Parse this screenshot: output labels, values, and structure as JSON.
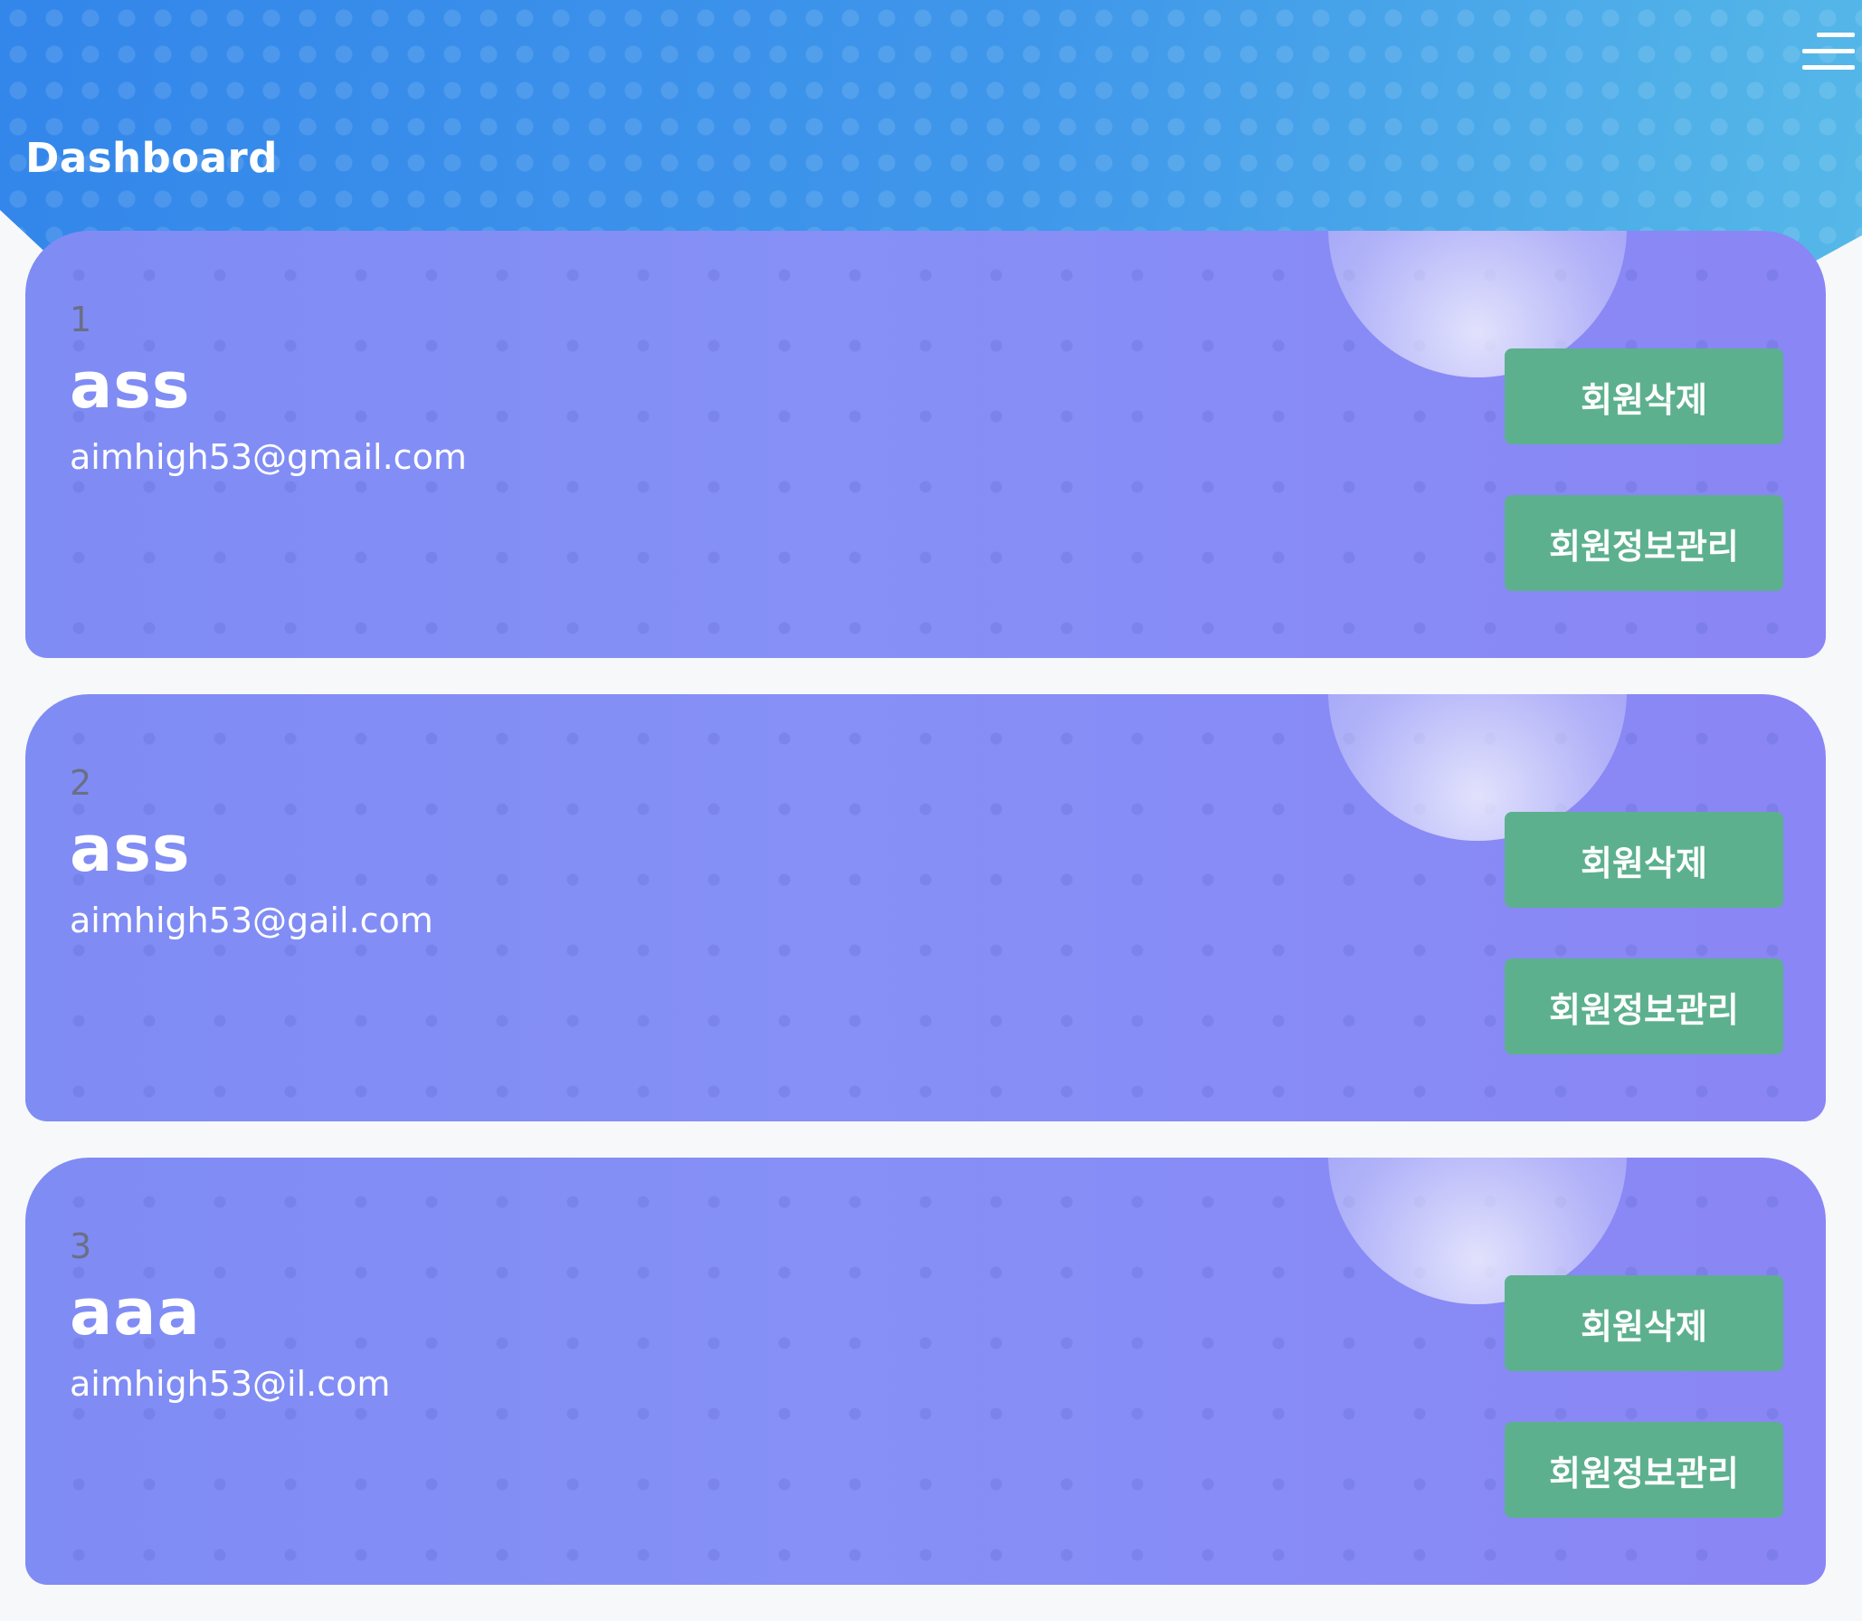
{
  "header": {
    "title": "Dashboard",
    "menu_icon": "hamburger-menu-icon"
  },
  "colors": {
    "header_gradient_start": "#3386ea",
    "header_gradient_end": "#55b8e8",
    "card_background": "#8690f6",
    "button_background": "#5cb08e",
    "page_background": "#f7f8fa"
  },
  "users": [
    {
      "number": "1",
      "name": "ass",
      "email": "aimhigh53@gmail.com",
      "delete_label": "회원삭제",
      "manage_label": "회원정보관리"
    },
    {
      "number": "2",
      "name": "ass",
      "email": "aimhigh53@gail.com",
      "delete_label": "회원삭제",
      "manage_label": "회원정보관리"
    },
    {
      "number": "3",
      "name": "aaa",
      "email": "aimhigh53@il.com",
      "delete_label": "회원삭제",
      "manage_label": "회원정보관리"
    }
  ]
}
